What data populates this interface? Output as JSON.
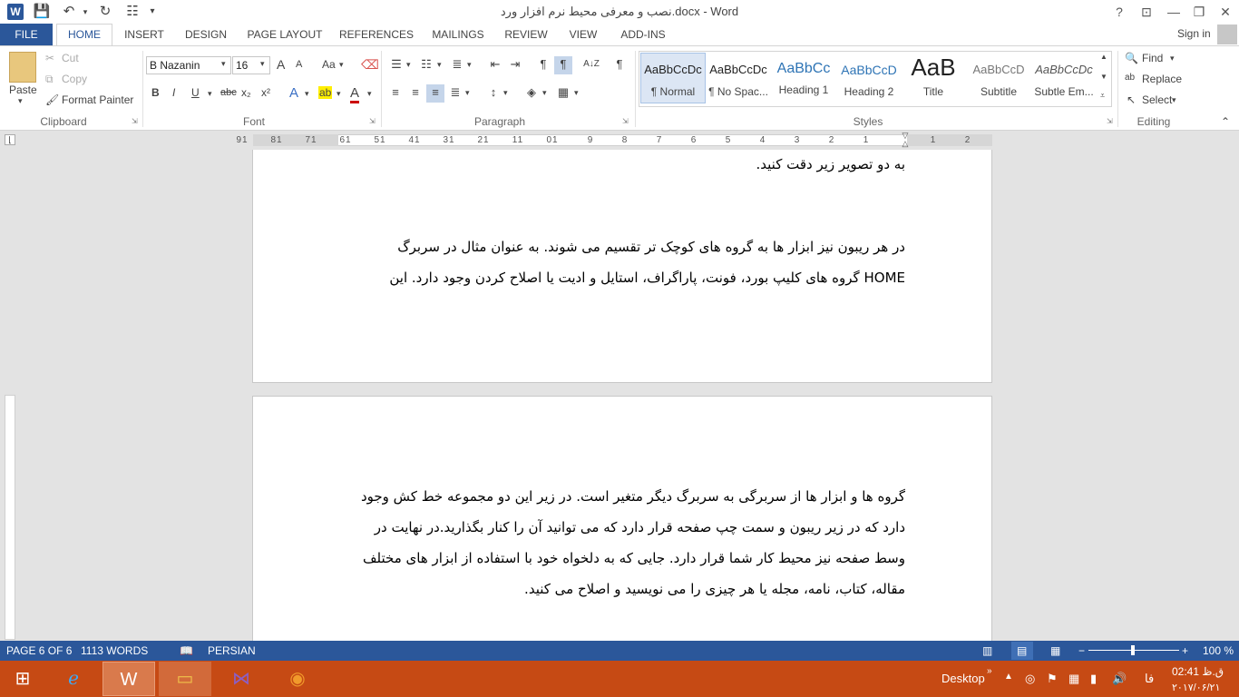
{
  "window": {
    "title": "نصب و معرفی محیط نرم افزار ورد.docx - Word",
    "help": "?",
    "restore_icon": "ribbon-display-icon",
    "minimize": "—",
    "maximize": "❐",
    "close": "✕"
  },
  "qat": {
    "save": "save-icon",
    "undo": "undo-icon",
    "redo": "redo-icon",
    "preview": "print-preview-icon",
    "customize": "▾"
  },
  "tabs": [
    "FILE",
    "HOME",
    "INSERT",
    "DESIGN",
    "PAGE LAYOUT",
    "REFERENCES",
    "MAILINGS",
    "REVIEW",
    "VIEW",
    "ADD-INS"
  ],
  "account": {
    "sign_in": "Sign in"
  },
  "clipboard": {
    "paste": "Paste",
    "cut": "Cut",
    "copy": "Copy",
    "format_painter": "Format Painter",
    "group": "Clipboard"
  },
  "font": {
    "name": "B Nazanin",
    "size": "16",
    "group": "Font",
    "bold": "B",
    "italic": "I",
    "underline": "U",
    "strike": "abc",
    "subscript": "x₂",
    "superscript": "x²",
    "text_effects": "A",
    "highlight": "ab",
    "font_color": "A",
    "grow": "A",
    "shrink": "A",
    "case": "Aa"
  },
  "paragraph": {
    "group": "Paragraph",
    "sort": "A↓Z",
    "show_marks": "¶"
  },
  "styles": {
    "group": "Styles",
    "items": [
      {
        "preview": "AaBbCcDc",
        "name": "¶ Normal"
      },
      {
        "preview": "AaBbCcDc",
        "name": "¶ No Spac..."
      },
      {
        "preview": "AaBbCc",
        "name": "Heading 1"
      },
      {
        "preview": "AaBbCcD",
        "name": "Heading 2"
      },
      {
        "preview": "AaB",
        "name": "Title"
      },
      {
        "preview": "AaBbCcD",
        "name": "Subtitle"
      },
      {
        "preview": "AaBbCcDc",
        "name": "Subtle Em..."
      }
    ]
  },
  "editing": {
    "find": "Find",
    "replace": "Replace",
    "select": "Select",
    "group": "Editing"
  },
  "ruler": {
    "ticks": [
      "91",
      "81",
      "71",
      "61",
      "51",
      "41",
      "31",
      "21",
      "11",
      "01",
      "9",
      "8",
      "7",
      "6",
      "5",
      "4",
      "3",
      "2",
      "1",
      "1",
      "2"
    ]
  },
  "document": {
    "page1": {
      "line1": "به دو تصویر زیر دقت کنید.",
      "line2": "در هر ریبون نیز ابزار ها به گروه های کوچک تر تقسیم می شوند. به عنوان مثال در سربرگ",
      "line3": "HOME گروه های کلیپ بورد، فونت، پاراگراف، استایل و ادیت یا اصلاح کردن وجود دارد. این"
    },
    "page2": {
      "line1": "گروه ها و ابزار ها از سربرگی به سربرگ دیگر متغیر است. در زیر این دو مجموعه خط کش وجود",
      "line2": "دارد که در زیر ریبون و سمت چپ صفحه قرار دارد که می توانید آن را کنار بگذارید.در نهایت در",
      "line3": "وسط صفحه نیز محیط کار شما قرار دارد. جایی که به دلخواه خود با استفاده از ابزار های مختلف",
      "line4": "مقاله، کتاب، نامه، مجله یا هر چیزی را می نویسید و اصلاح می کنید."
    }
  },
  "status": {
    "page": "PAGE 6 OF 6",
    "words": "1113 WORDS",
    "language": "PERSIAN",
    "zoom": "100 %",
    "zoom_out": "−",
    "zoom_in": "+"
  },
  "taskbar": {
    "desktop": "Desktop",
    "lang": "فا",
    "time": "02:41 ق.ظ",
    "date": "۲۰۱۷/۰۶/۲۱"
  }
}
